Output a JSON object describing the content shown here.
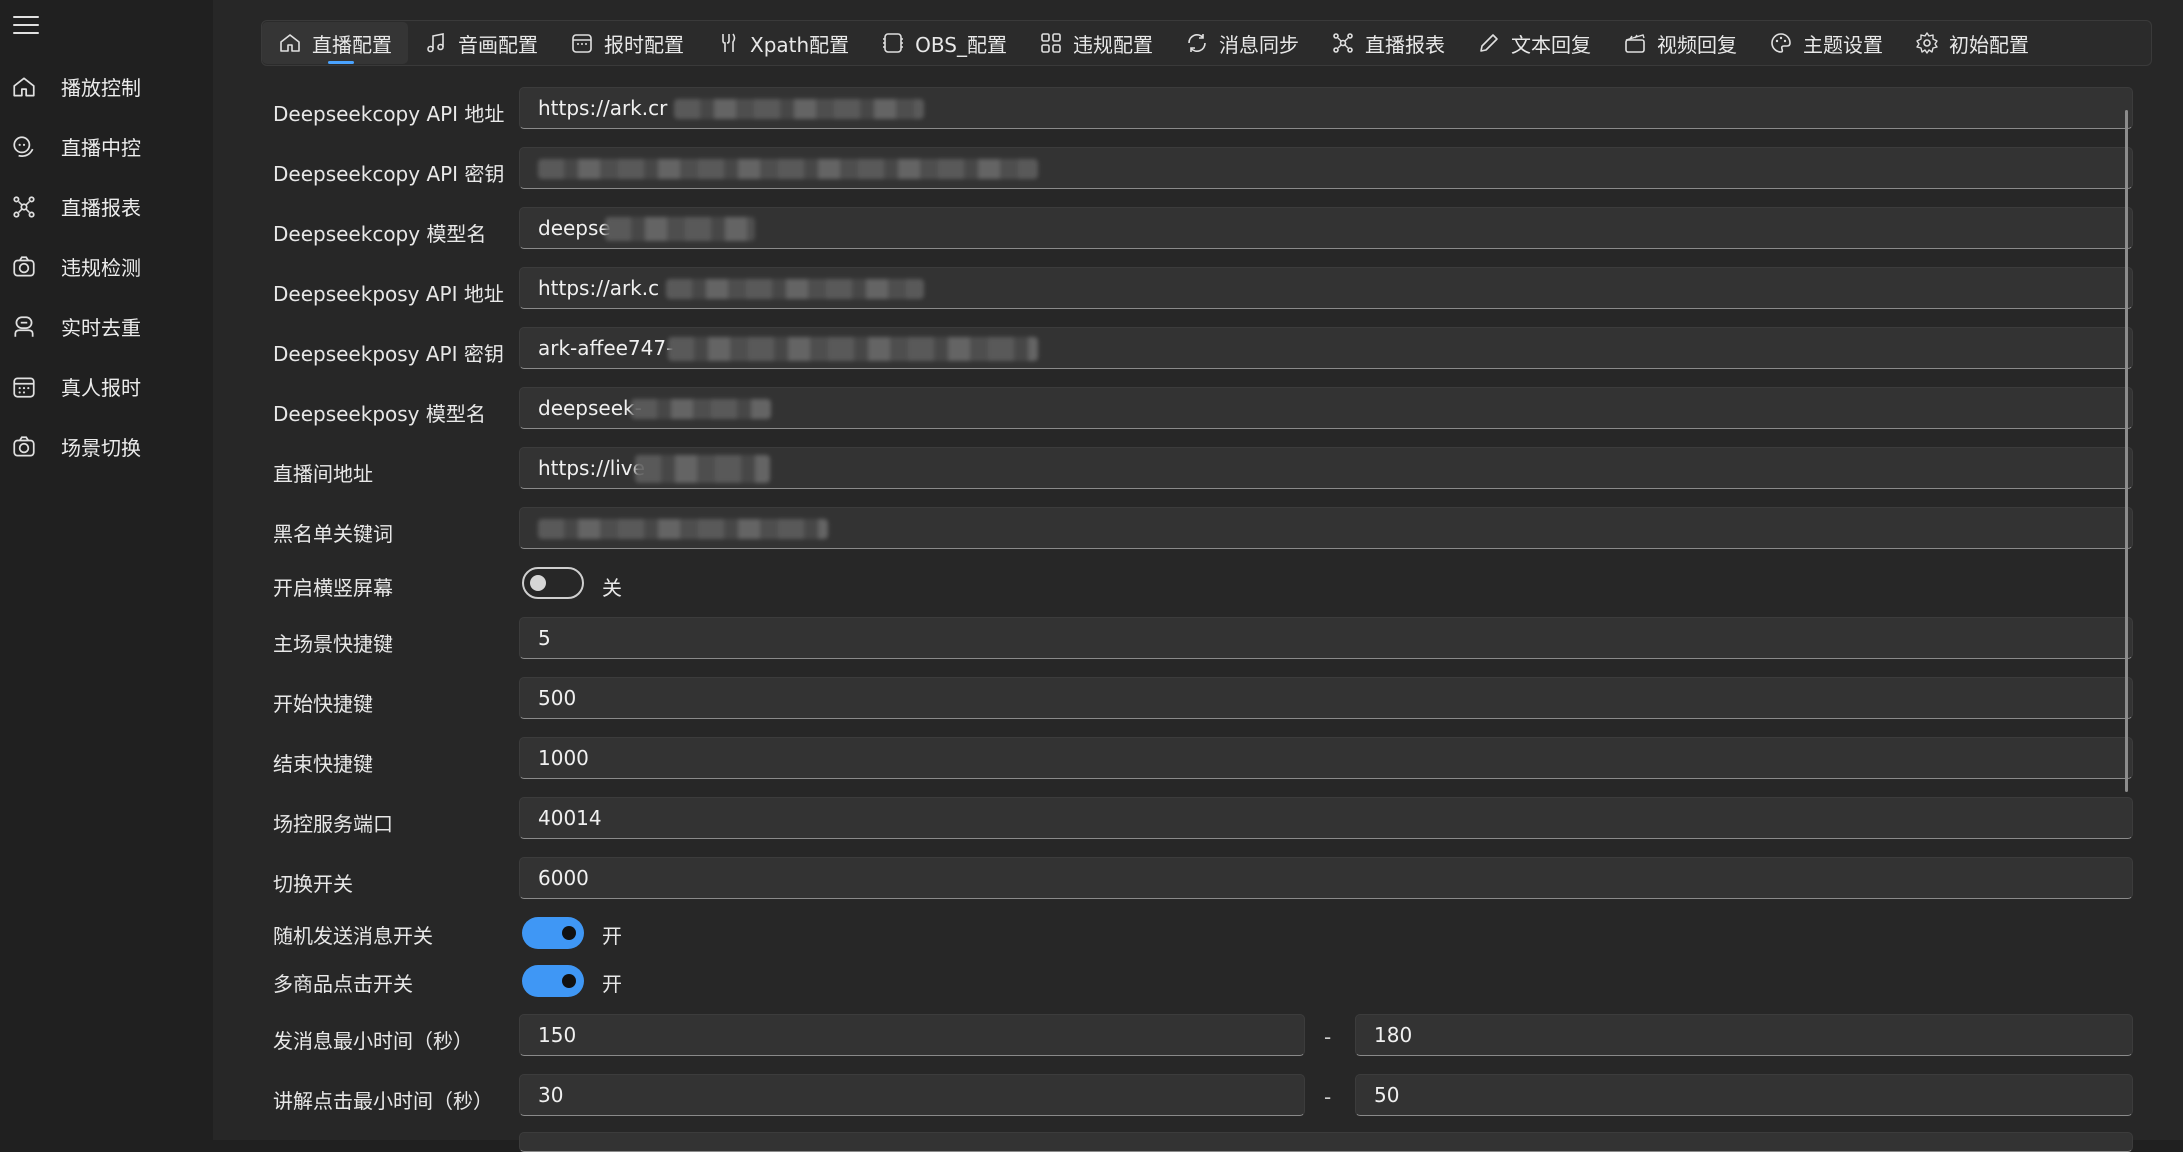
{
  "sidebar": {
    "items": [
      {
        "label": "播放控制"
      },
      {
        "label": "直播中控"
      },
      {
        "label": "直播报表"
      },
      {
        "label": "违规检测"
      },
      {
        "label": "实时去重"
      },
      {
        "label": "真人报时"
      },
      {
        "label": "场景切换"
      }
    ]
  },
  "tabs": [
    {
      "label": "直播配置",
      "icon": "home-icon"
    },
    {
      "label": "音画配置",
      "icon": "music-icon"
    },
    {
      "label": "报时配置",
      "icon": "calendar-icon"
    },
    {
      "label": "Xpath配置",
      "icon": "tool-icon"
    },
    {
      "label": "OBS_配置",
      "icon": "obs-icon"
    },
    {
      "label": "违规配置",
      "icon": "grid-icon"
    },
    {
      "label": "消息同步",
      "icon": "sync-icon"
    },
    {
      "label": "直播报表",
      "icon": "nodes-icon"
    },
    {
      "label": "文本回复",
      "icon": "pencil-icon"
    },
    {
      "label": "视频回复",
      "icon": "clapper-icon"
    },
    {
      "label": "主题设置",
      "icon": "palette-icon"
    },
    {
      "label": "初始配置",
      "icon": "gear-icon"
    }
  ],
  "form": {
    "copy_api_url": {
      "label": "Deepseekcopy API 地址",
      "value": "https://ark.cr"
    },
    "copy_api_key": {
      "label": "Deepseekcopy API 密钥",
      "value": ""
    },
    "copy_model": {
      "label": "Deepseekcopy 模型名",
      "value": "deepse"
    },
    "posy_api_url": {
      "label": "Deepseekposy API 地址",
      "value": "https://ark.c"
    },
    "posy_api_key": {
      "label": "Deepseekposy API 密钥",
      "value": "ark-affee747-"
    },
    "posy_model": {
      "label": "Deepseekposy 模型名",
      "value": "deepseek-"
    },
    "room_url": {
      "label": "直播间地址",
      "value": "https://live"
    },
    "blacklist": {
      "label": "黑名单关键词",
      "value": ""
    },
    "screen_toggle": {
      "label": "开启横竖屏幕",
      "state": "关",
      "on": false
    },
    "main_scene_key": {
      "label": "主场景快捷键",
      "value": "5"
    },
    "start_key": {
      "label": "开始快捷键",
      "value": "500"
    },
    "end_key": {
      "label": "结束快捷键",
      "value": "1000"
    },
    "service_port": {
      "label": "场控服务端口",
      "value": "40014"
    },
    "switch_value": {
      "label": "切换开关",
      "value": "6000"
    },
    "random_msg_toggle": {
      "label": "随机发送消息开关",
      "state": "开",
      "on": true
    },
    "multi_click_toggle": {
      "label": "多商品点击开关",
      "state": "开",
      "on": true
    },
    "msg_interval": {
      "label": "发消息最小时间（秒）",
      "min": "150",
      "dash": "-",
      "max": "180"
    },
    "click_interval": {
      "label": "讲解点击最小时间（秒）",
      "min": "30",
      "dash": "-",
      "max": "50"
    }
  },
  "colors": {
    "accent": "#3f97f5",
    "background": "#272727",
    "sidebar": "#202020"
  }
}
